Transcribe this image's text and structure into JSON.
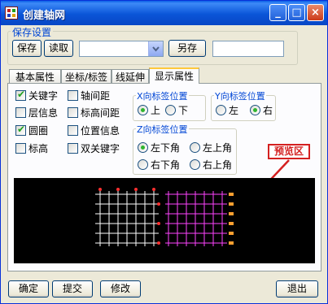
{
  "window": {
    "title": "创建轴网",
    "minimize": "_",
    "maximize": "□",
    "close": "×"
  },
  "save_settings": {
    "title": "保存设置",
    "save_label": "保存",
    "read_label": "读取",
    "select_value": "",
    "save_as_label": "另存",
    "name_value": ""
  },
  "tabs": [
    "基本属性",
    "坐标/标签",
    "线延伸",
    "显示属性"
  ],
  "active_tab": "显示属性",
  "display": {
    "checkboxes": [
      {
        "label": "关键字",
        "checked": true
      },
      {
        "label": "层信息",
        "checked": false
      },
      {
        "label": "圆圈",
        "checked": true
      },
      {
        "label": "标高",
        "checked": false
      },
      {
        "label": "轴间距",
        "checked": false
      },
      {
        "label": "标高间距",
        "checked": false
      },
      {
        "label": "位置信息",
        "checked": false
      },
      {
        "label": "双关键字",
        "checked": false
      }
    ],
    "x_label_pos": {
      "title": "X向标签位置",
      "options": [
        "上",
        "下"
      ],
      "selected": "上"
    },
    "y_label_pos": {
      "title": "Y向标签位置",
      "options": [
        "左",
        "右"
      ],
      "selected": "右"
    },
    "z_label_pos": {
      "title": "Z向标签位置",
      "options": [
        "左下角",
        "左上角",
        "右下角",
        "右上角"
      ],
      "selected": "左下角"
    }
  },
  "preview": {
    "label": "预览区",
    "accent": "#d42020",
    "grid1_color": "#ffffff",
    "grid2_color": "#ff44ff"
  },
  "bottom_buttons": {
    "ok": "确定",
    "submit": "提交",
    "modify": "修改",
    "exit": "退出"
  }
}
